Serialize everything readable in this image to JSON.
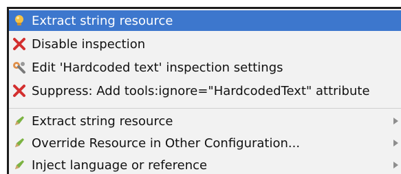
{
  "menu": {
    "items": [
      {
        "label": "Extract string resource",
        "icon": "lightbulb-icon",
        "submenu": false
      },
      {
        "label": "Disable inspection",
        "icon": "red-x-icon",
        "submenu": false
      },
      {
        "label": "Edit 'Hardcoded text' inspection settings",
        "icon": "wrench-gear-icon",
        "submenu": false
      },
      {
        "label": "Suppress: Add tools:ignore=\"HardcodedText\" attribute",
        "icon": "red-x-icon",
        "submenu": false
      },
      {
        "label": "Extract string resource",
        "icon": "pencil-icon",
        "submenu": true
      },
      {
        "label": "Override Resource in Other Configuration...",
        "icon": "pencil-icon",
        "submenu": true
      },
      {
        "label": "Inject language or reference",
        "icon": "pencil-icon",
        "submenu": true
      }
    ]
  },
  "colors": {
    "selection": "#3d77cd",
    "menu_background": "#f2f2f2",
    "text": "#111111",
    "red_x": "#d32f2f",
    "pencil_green": "#7cb342",
    "submenu_arrow": "#8e8e8e"
  }
}
